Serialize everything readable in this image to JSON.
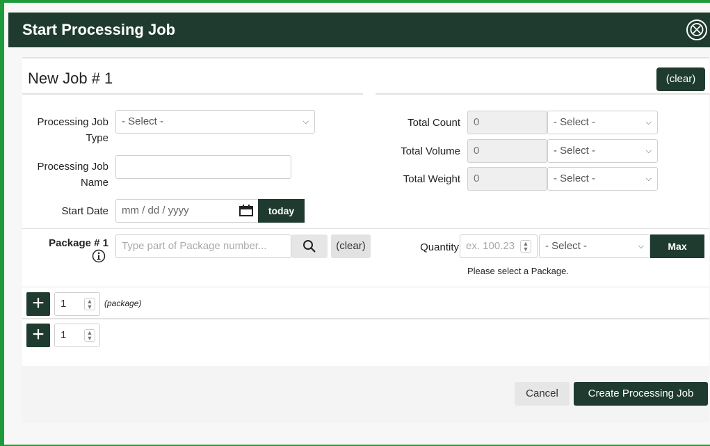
{
  "dialog": {
    "title": "Start Processing Job",
    "close_symbol": "⨂"
  },
  "job": {
    "title": "New Job # 1",
    "clear_label": "(clear)"
  },
  "fields": {
    "processing_job_type_label": "Processing Job Type",
    "processing_job_type_value": "- Select -",
    "processing_job_name_label": "Processing Job Name",
    "processing_job_name_value": "",
    "start_date_label": "Start Date",
    "start_date_placeholder": "mm / dd / yyyy",
    "today_label": "today"
  },
  "totals": {
    "count_label": "Total Count",
    "count_value": "0",
    "count_unit": "- Select -",
    "volume_label": "Total Volume",
    "volume_value": "0",
    "volume_unit": "- Select -",
    "weight_label": "Total Weight",
    "weight_value": "0",
    "weight_unit": "- Select -"
  },
  "package": {
    "label": "Package # 1",
    "search_placeholder": "Type part of Package number...",
    "clear_label": "(clear)",
    "quantity_label": "Quantity",
    "quantity_placeholder": "ex. 100.23",
    "quantity_unit": "- Select -",
    "max_label": "Max",
    "hint": "Please select a Package."
  },
  "adders": {
    "package_count": "1",
    "package_suffix": "(package)",
    "second_count": "1"
  },
  "footer": {
    "cancel_label": "Cancel",
    "create_label": "Create Processing Job"
  },
  "colors": {
    "header_bg": "#1f3b30",
    "border_green": "#1f9a3a"
  }
}
